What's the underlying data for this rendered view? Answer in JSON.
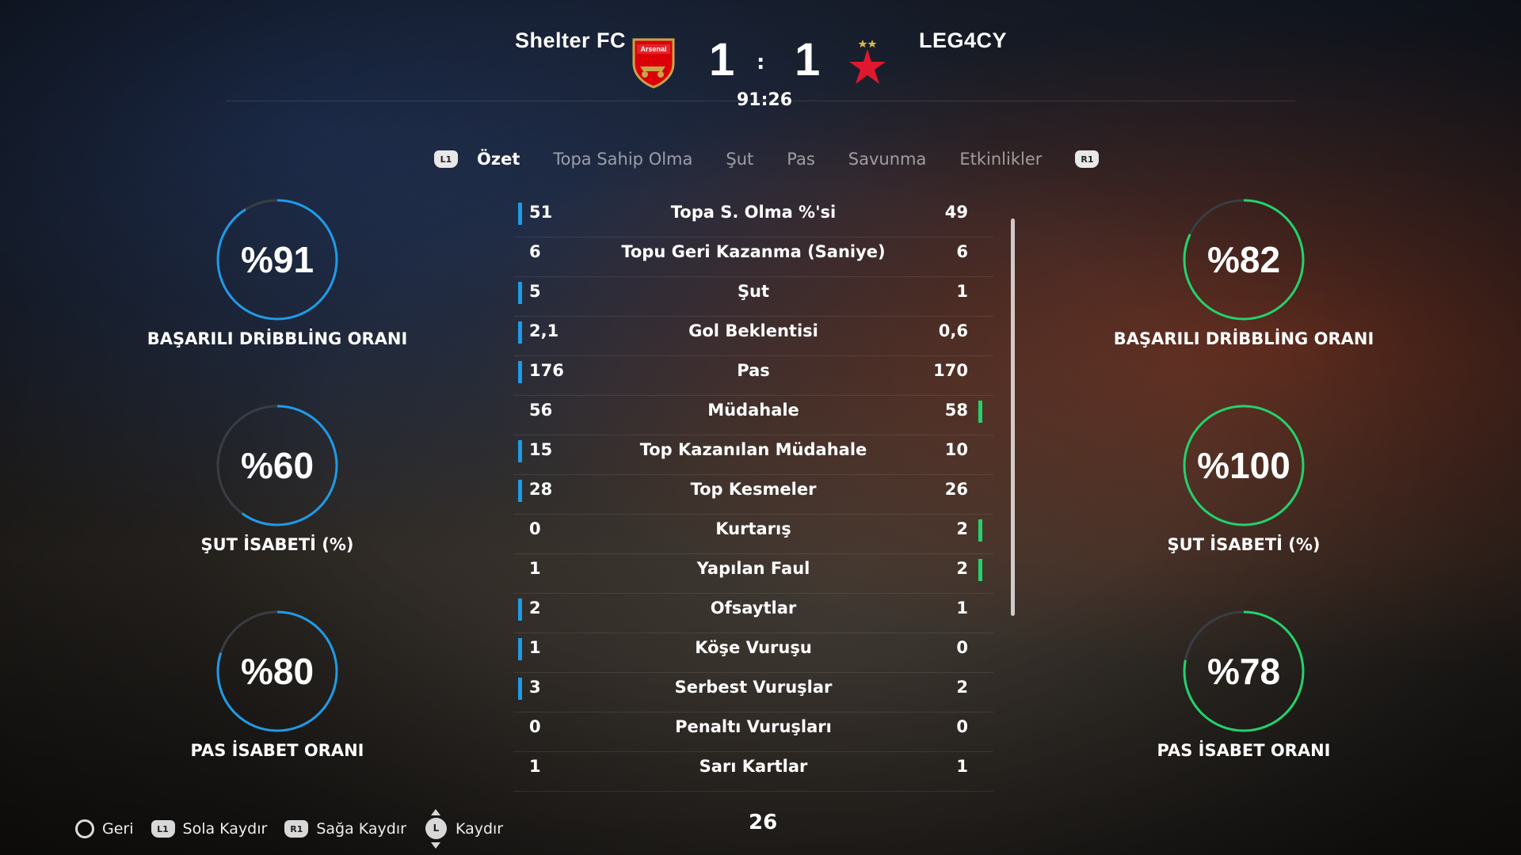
{
  "match": {
    "home_team": "Shelter FC",
    "away_team": "LEG4CY",
    "home_score": "1",
    "away_score": "1",
    "separator": ":",
    "clock": "91:26",
    "home_crest_text": "Arsenal"
  },
  "tabs": {
    "left_button": "L1",
    "right_button": "R1",
    "items": [
      "Özet",
      "Topa Sahip Olma",
      "Şut",
      "Pas",
      "Savunma",
      "Etkinlikler"
    ],
    "active": "Özet"
  },
  "stats": [
    {
      "label": "Topa S. Olma %'si",
      "home": "51",
      "away": "49",
      "leader": "home"
    },
    {
      "label": "Topu Geri Kazanma (Saniye)",
      "home": "6",
      "away": "6",
      "leader": "none"
    },
    {
      "label": "Şut",
      "home": "5",
      "away": "1",
      "leader": "home"
    },
    {
      "label": "Gol Beklentisi",
      "home": "2,1",
      "away": "0,6",
      "leader": "home"
    },
    {
      "label": "Pas",
      "home": "176",
      "away": "170",
      "leader": "home"
    },
    {
      "label": "Müdahale",
      "home": "56",
      "away": "58",
      "leader": "away"
    },
    {
      "label": "Top Kazanılan Müdahale",
      "home": "15",
      "away": "10",
      "leader": "home"
    },
    {
      "label": "Top Kesmeler",
      "home": "28",
      "away": "26",
      "leader": "home"
    },
    {
      "label": "Kurtarış",
      "home": "0",
      "away": "2",
      "leader": "away"
    },
    {
      "label": "Yapılan Faul",
      "home": "1",
      "away": "2",
      "leader": "away"
    },
    {
      "label": "Ofsaytlar",
      "home": "2",
      "away": "1",
      "leader": "home"
    },
    {
      "label": "Köşe Vuruşu",
      "home": "1",
      "away": "0",
      "leader": "home"
    },
    {
      "label": "Serbest Vuruşlar",
      "home": "3",
      "away": "2",
      "leader": "home"
    },
    {
      "label": "Penaltı Vuruşları",
      "home": "0",
      "away": "0",
      "leader": "none"
    },
    {
      "label": "Sarı Kartlar",
      "home": "1",
      "away": "1",
      "leader": "none"
    }
  ],
  "home_rings": [
    {
      "value_text": "%91",
      "percent": 91,
      "label": "BAŞARILI DRİBBLİNG ORANI"
    },
    {
      "value_text": "%60",
      "percent": 60,
      "label": "ŞUT İSABETİ (%)"
    },
    {
      "value_text": "%80",
      "percent": 80,
      "label": "PAS İSABET ORANI"
    }
  ],
  "away_rings": [
    {
      "value_text": "%82",
      "percent": 82,
      "label": "BAŞARILI DRİBBLİNG ORANI"
    },
    {
      "value_text": "%100",
      "percent": 100,
      "label": "ŞUT İSABETİ (%)"
    },
    {
      "value_text": "%78",
      "percent": 78,
      "label": "PAS İSABET ORANI"
    }
  ],
  "colors": {
    "home": "#1e9be8",
    "away": "#22d36a",
    "track": "#3a3d44"
  },
  "footer": {
    "back_label": "Geri",
    "left_button": "L1",
    "left_label": "Sola Kaydır",
    "right_button": "R1",
    "right_label": "Sağa Kaydır",
    "stick_button": "L",
    "scroll_label": "Kaydır",
    "page_number": "26"
  }
}
